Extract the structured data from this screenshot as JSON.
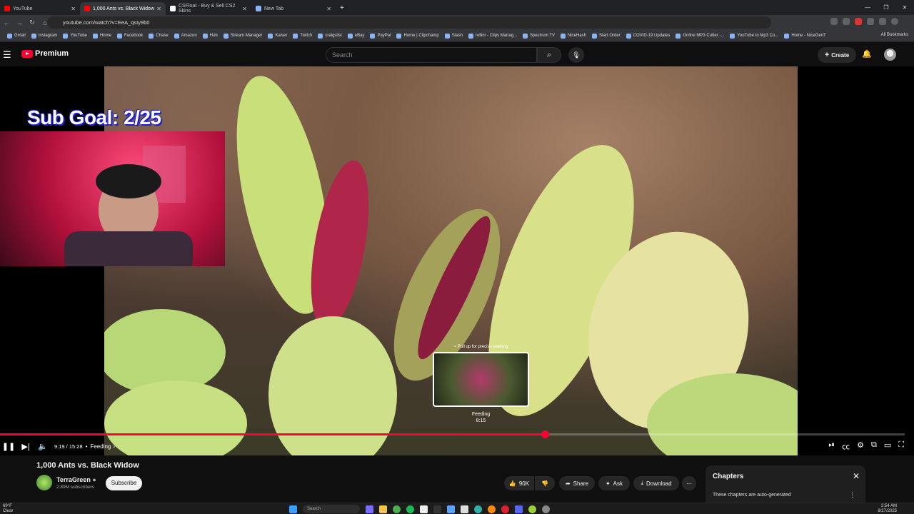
{
  "browser": {
    "tabs": [
      {
        "label": "YouTube",
        "color": "#ff0000"
      },
      {
        "label": "1,000 Ants vs. Black Widow",
        "color": "#ff0000",
        "active": true
      },
      {
        "label": "CSFloat - Buy & Sell CS2 Skins",
        "color": "#ffffff"
      },
      {
        "label": "New Tab",
        "color": "#8ab4f8"
      }
    ],
    "new_tab": "+",
    "url": "youtube.com/watch?v=EeA_qsIy9b0",
    "bookmarks": [
      "Gmail",
      "Instagram",
      "YouTube",
      "Home",
      "Facebook",
      "Chase",
      "Amazon",
      "Hub",
      "Stream Manager",
      "Kaiser",
      "Twitch",
      "craigslist",
      "eBay",
      "PayPal",
      "Home | Clipchamp",
      "Stash",
      "rellim - Clips Manag...",
      "Spectrum TV",
      "NiceHash",
      "Start Order",
      "COVID-19 Updates",
      "Online MP3 Cutter -...",
      "YouTube to Mp3 Co...",
      "Home - NiceGenT"
    ],
    "all_bookmarks": "All Bookmarks"
  },
  "youtube": {
    "logo": "Premium",
    "search_placeholder": "Search",
    "create_label": "Create"
  },
  "player": {
    "overlay_text": "Sub Goal: 2/25",
    "preview_hint": "≈ Pull up for precise seeking",
    "preview_chapter": "Feeding",
    "preview_time": "8:15",
    "time_display": "9:19 / 15:28",
    "chapter": "Feeding",
    "progress": 0.602
  },
  "video": {
    "title": "1,000 Ants vs. Black Widow",
    "channel": "TerraGreen",
    "subscribers": "2.89M subscribers",
    "subscribe_label": "Subscribe",
    "likes": "90K",
    "share_label": "Share",
    "ask_label": "Ask",
    "download_label": "Download"
  },
  "chapters": {
    "title": "Chapters",
    "note": "These chapters are auto-generated"
  },
  "taskbar": {
    "temp": "69°F",
    "weather": "Clear",
    "search_placeholder": "Search",
    "time": "2:54 AM",
    "date": "8/27/2025"
  }
}
